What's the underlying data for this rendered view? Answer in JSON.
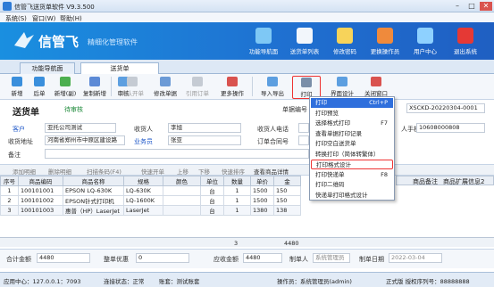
{
  "window": {
    "title": "信管飞送货单软件 V9.3.500",
    "min": "–",
    "max": "□",
    "close": "✕"
  },
  "menubar": [
    "系统(S)",
    "窗口(W)",
    "帮助(H)"
  ],
  "banner": {
    "brand": "信管飞",
    "slogan": "精细化管理软件",
    "buttons": [
      "功能导航面",
      "送货单列表",
      "修改密码",
      "更换操作员",
      "用户中心",
      "退出系统"
    ]
  },
  "tabs": [
    "功能导航面",
    "送货单"
  ],
  "toolbar": [
    "新增",
    "后单",
    "新增(副)",
    "复制新增",
    "审核",
    "确认开单",
    "修改单据",
    "引用订单",
    "更多操作",
    "导入导出",
    "打印",
    "界面设计",
    "关闭窗口"
  ],
  "form": {
    "title": "送货单",
    "status": "待审核",
    "order_no_label": "单据编号",
    "order_no": "XSCKD-20220304-0001",
    "customer_label": "客户",
    "customer": "亚托公司测试",
    "receiver_label": "收货人",
    "receiver": "李旭",
    "receiver_tel_label": "收货人电话",
    "mobile_label": "人手机",
    "mobile": "10608000808",
    "address_label": "收货地址",
    "address": "河南省郑州市中原区建设路",
    "salesman_label": "业务员",
    "salesman": "张亚",
    "order_sheet_label": "订单合同号",
    "remark_label": "备注"
  },
  "grid_toolbar": [
    "添加明细",
    "删除明细",
    "扫描条码(F4)",
    "快速开单",
    "上移",
    "下移",
    "快速排序",
    "查看商品详情"
  ],
  "grid": {
    "headers": [
      "序号",
      "商品编码",
      "商品名称",
      "规格",
      "颜色",
      "单位",
      "数量",
      "单价",
      "金"
    ],
    "right_headers": [
      "商品备注",
      "商品扩展信息2"
    ],
    "rows": [
      [
        "1",
        "100101001",
        "EPSON LQ-630K",
        "LQ-630K",
        "",
        "台",
        "1",
        "1500",
        "150"
      ],
      [
        "2",
        "100101002",
        "EPSON针式打印机",
        "LQ-1600K",
        "",
        "台",
        "1",
        "1500",
        "150"
      ],
      [
        "3",
        "100101003",
        "惠普（HP）LaserJet",
        "LaserJet",
        "",
        "台",
        "1",
        "1380",
        "138"
      ]
    ],
    "sum_qty": "3",
    "sum_amount": "4480"
  },
  "footer": {
    "total_label": "合计金额",
    "total": "4480",
    "discount_label": "整单优惠",
    "discount": "0",
    "receivable_label": "应收金额",
    "receivable": "4480",
    "maker_label": "制单人",
    "maker": "系统管理员",
    "date_label": "制单日期",
    "date": "2022-03-04"
  },
  "statusbar": {
    "server": "应用中心：127.0.0.1：7093",
    "conn": "连接状态：正常",
    "account": "账套：测试账套",
    "operator": "操作员：系统管理员(admin)",
    "auth": "正式版 授权序列号：88888888"
  },
  "print_menu": {
    "items": [
      {
        "label": "打印",
        "shortcut": "Ctrl+P"
      },
      {
        "label": "打印预览",
        "shortcut": ""
      },
      {
        "label": "选择格式打印",
        "shortcut": "F7"
      },
      {
        "label": "查看单据打印记录",
        "shortcut": ""
      },
      {
        "label": "打印空白送货单",
        "shortcut": ""
      },
      {
        "label": "转换打印（简体转繁体）",
        "shortcut": ""
      },
      {
        "label": "打印格式设计",
        "shortcut": ""
      },
      {
        "label": "打印快递单",
        "shortcut": "F8"
      },
      {
        "label": "打印二维码",
        "shortcut": ""
      },
      {
        "label": "快递单打印格式设计",
        "shortcut": ""
      }
    ]
  }
}
